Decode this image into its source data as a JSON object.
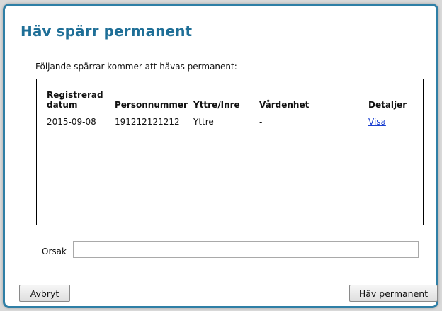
{
  "dialog": {
    "title": "Häv spärr permanent",
    "intro": "Följande spärrar kommer att hävas permanent:"
  },
  "table": {
    "headers": {
      "date": "Registrerad datum",
      "personnummer": "Personnummer",
      "yttre_inre": "Yttre/Inre",
      "vardenhet": "Vårdenhet",
      "detaljer": "Detaljer"
    },
    "rows": [
      {
        "date": "2015-09-08",
        "personnummer": "191212121212",
        "yttre_inre": "Yttre",
        "vardenhet": "-",
        "detaljer": "Visa"
      }
    ]
  },
  "reason": {
    "label": "Orsak",
    "value": ""
  },
  "buttons": {
    "cancel": "Avbryt",
    "confirm": "Häv permanent"
  },
  "colors": {
    "accent": "#1f6f97",
    "border": "#2f7fa6",
    "link": "#1a3fd0"
  }
}
